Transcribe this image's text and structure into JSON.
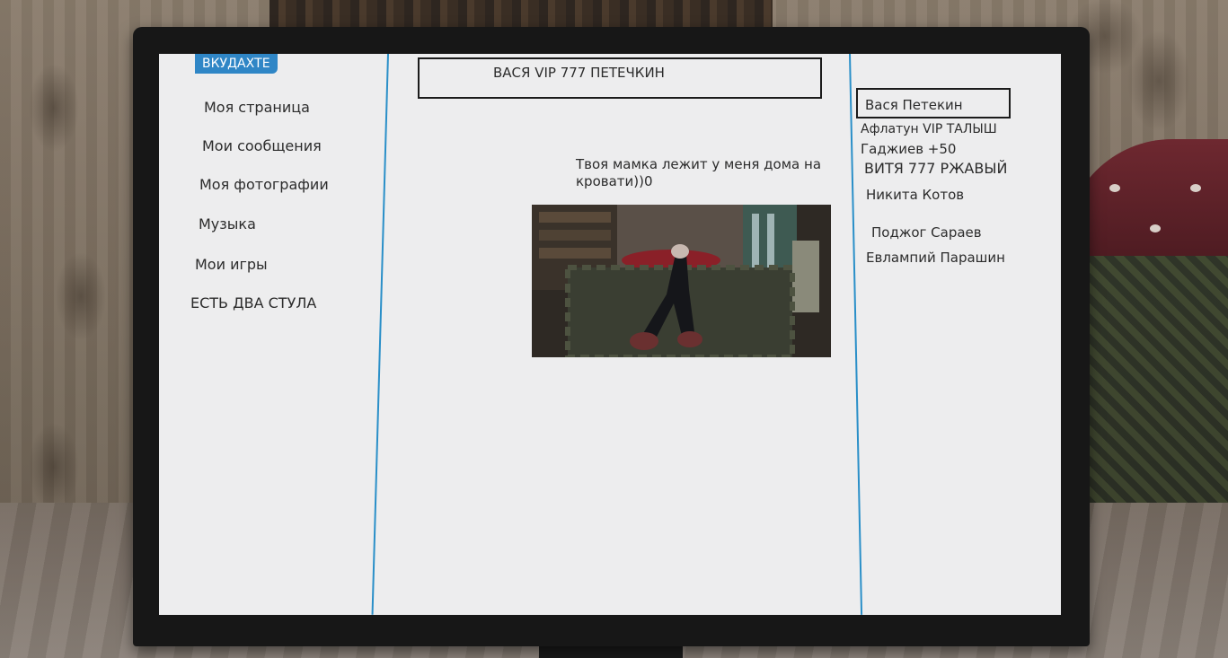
{
  "site": {
    "logo": "ВКУДАХТЕ"
  },
  "nav": [
    {
      "label": "Моя страница"
    },
    {
      "label": "Мои сообщения"
    },
    {
      "label": "Моя фотографии"
    },
    {
      "label": "Музыка"
    },
    {
      "label": "Мои игры"
    },
    {
      "label": "ЕСТЬ ДВА СТУЛА"
    }
  ],
  "profile": {
    "name": "ВАСЯ VIP 777 ПЕТЕЧКИН"
  },
  "post": {
    "text": "Твоя мамка лежит у меня дома на кровати))0"
  },
  "friends": [
    {
      "name": "Вася Петекин"
    },
    {
      "name": "Афлатун VIP ТАЛЫШ"
    },
    {
      "name": "Гаджиев  +50"
    },
    {
      "name": "ВИТЯ 777 РЖАВЫЙ"
    },
    {
      "name": "Никита Котов"
    },
    {
      "name": "Поджог Сараев"
    },
    {
      "name": "Евлампий Парашин"
    }
  ],
  "colors": {
    "accent": "#2f86c6",
    "screen_bg": "#ededee",
    "text": "#2c2c2c"
  }
}
